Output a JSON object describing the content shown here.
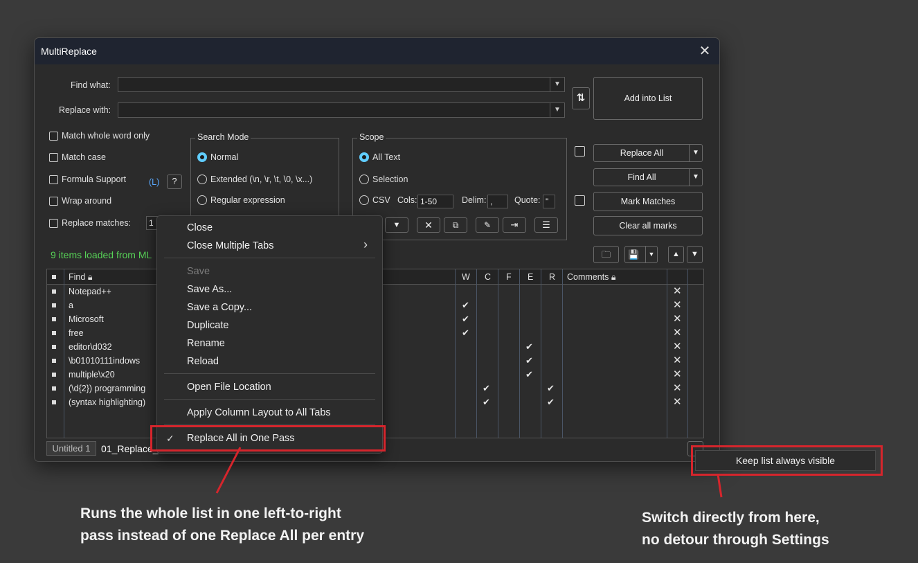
{
  "window": {
    "title": "MultiReplace",
    "close_glyph": "✕"
  },
  "find": {
    "label": "Find what:",
    "value": ""
  },
  "replace": {
    "label": "Replace with:",
    "value": ""
  },
  "buttons": {
    "add_into_list": "Add into List",
    "replace_all": "Replace All",
    "find_all": "Find All",
    "mark_matches": "Mark Matches",
    "clear_all_marks": "Clear all marks",
    "help": "?",
    "formula_link": "(L)"
  },
  "options": {
    "match_whole_word": "Match whole word only",
    "match_case": "Match case",
    "formula_support": "Formula Support",
    "wrap_around": "Wrap around",
    "replace_matches": "Replace matches:",
    "replace_matches_value": "1"
  },
  "search_mode": {
    "title": "Search Mode",
    "normal": "Normal",
    "extended": "Extended (\\n, \\r, \\t, \\0, \\x...)",
    "regex": "Regular expression"
  },
  "scope": {
    "title": "Scope",
    "all_text": "All Text",
    "selection": "Selection",
    "csv": "CSV",
    "cols_label": "Cols:",
    "cols_value": "1-50",
    "delim_label": "Delim:",
    "delim_value": ",",
    "quote_label": "Quote:",
    "quote_value": "\""
  },
  "status": {
    "text": "9 items loaded from ML",
    "color": "#57d257"
  },
  "list": {
    "headers": {
      "find": "Find",
      "w": "W",
      "c": "C",
      "f": "F",
      "e": "E",
      "r": "R",
      "comments": "Comments"
    },
    "rows": [
      {
        "find": "Notepad++",
        "w": false,
        "c": false,
        "f": false,
        "e": false,
        "r": false
      },
      {
        "find": "a",
        "w": true,
        "c": false,
        "f": false,
        "e": false,
        "r": false
      },
      {
        "find": "Microsoft",
        "w": true,
        "c": false,
        "f": false,
        "e": false,
        "r": false
      },
      {
        "find": "free",
        "w": true,
        "c": false,
        "f": false,
        "e": false,
        "r": false
      },
      {
        "find": "editor\\d032",
        "w": false,
        "c": false,
        "f": false,
        "e": true,
        "r": false
      },
      {
        "find": "\\b01010111indows",
        "w": false,
        "c": false,
        "f": false,
        "e": true,
        "r": false
      },
      {
        "find": "multiple\\x20",
        "w": false,
        "c": false,
        "f": false,
        "e": true,
        "r": false
      },
      {
        "find": "(\\d{2}) programming",
        "w": false,
        "c": true,
        "f": false,
        "e": false,
        "r": true
      },
      {
        "find": "(syntax highlighting)",
        "w": false,
        "c": true,
        "f": false,
        "e": false,
        "r": true
      }
    ]
  },
  "tabs": {
    "tab1": "Untitled 1",
    "tab2": "01_Replace_"
  },
  "context_menu": {
    "close": "Close",
    "close_multiple_tabs": "Close Multiple Tabs",
    "save": "Save",
    "save_as": "Save As...",
    "save_copy": "Save a Copy...",
    "duplicate": "Duplicate",
    "rename": "Rename",
    "reload": "Reload",
    "open_file_location": "Open File Location",
    "apply_column_layout": "Apply Column Layout to All Tabs",
    "replace_all_one_pass": "Replace All in One Pass",
    "check_glyph": "✓",
    "submenu_glyph": "›"
  },
  "popup": {
    "keep_visible": "Keep list always visible"
  },
  "annotations": {
    "left_line1": "Runs the whole list in one left-to-right",
    "left_line2": "pass instead of one Replace All per entry",
    "right_line1": "Switch directly from here,",
    "right_line2": "no detour through Settings",
    "highlight_color": "#d6252c"
  }
}
